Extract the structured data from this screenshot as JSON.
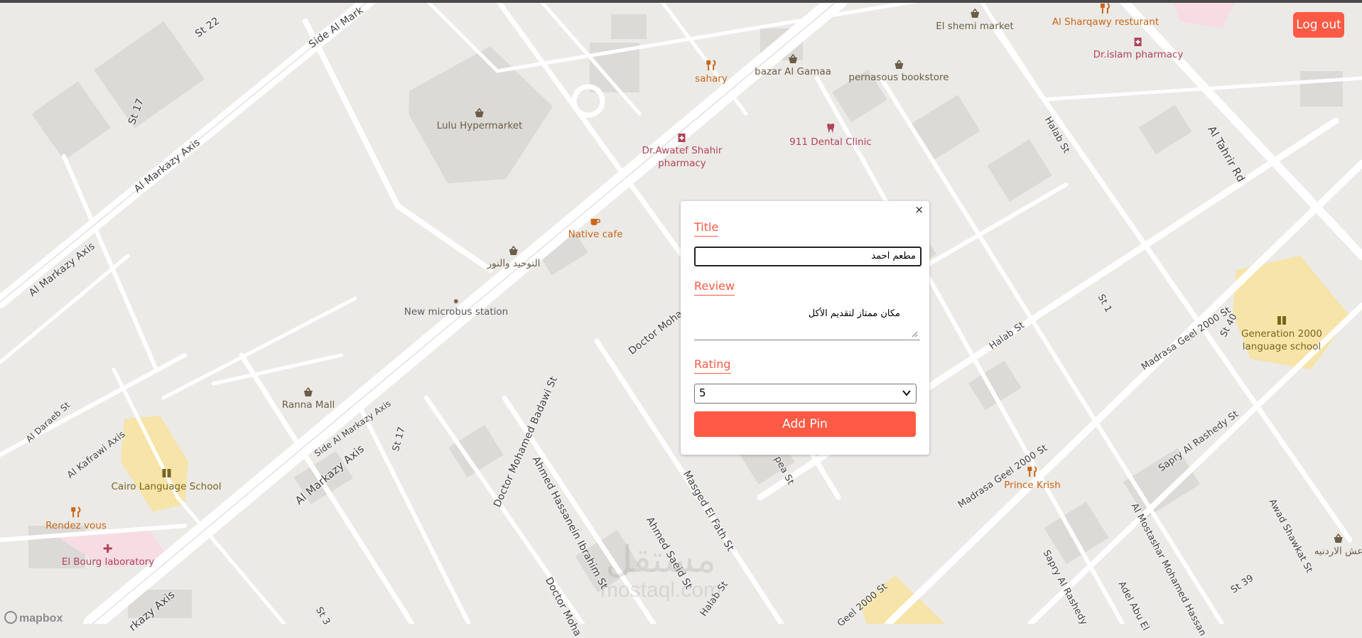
{
  "colors": {
    "accent": "#ff5a45",
    "food": "#c8661a",
    "health": "#b0435a",
    "shop": "#6b5d48",
    "school_area": "#f6e4a8"
  },
  "header": {
    "logout_label": "Log out"
  },
  "form": {
    "close_glyph": "×",
    "title_label": "Title",
    "title_value": "مطعم احمد",
    "review_label": "Review",
    "review_value": "مكان ممتاز لتقديم الأكل",
    "rating_label": "Rating",
    "rating_value": "5",
    "submit_label": "Add Pin"
  },
  "pois": [
    {
      "label": "Lulu Hypermarket",
      "icon": "basket-icon",
      "kind": "shop"
    },
    {
      "label": "sahary",
      "icon": "restaurant-icon",
      "kind": "food"
    },
    {
      "label": "bazar Al Gamaa",
      "icon": "basket-icon",
      "kind": "shop"
    },
    {
      "label": "pernasous bookstore",
      "icon": "basket-icon",
      "kind": "shop"
    },
    {
      "label": "El shemi market",
      "icon": "basket-icon",
      "kind": "shop"
    },
    {
      "label": "Al Sharqawy resturant",
      "icon": "restaurant-icon",
      "kind": "food"
    },
    {
      "label": "Dr.islam pharmacy",
      "icon": "pharmacy-icon",
      "kind": "health"
    },
    {
      "label": "Dr.Awatef Shahir",
      "label2": "pharmacy",
      "icon": "pharmacy-icon",
      "kind": "health"
    },
    {
      "label": "911 Dental Clinic",
      "icon": "tooth-icon",
      "kind": "health"
    },
    {
      "label": "Native cafe",
      "icon": "cafe-icon",
      "kind": "food"
    },
    {
      "label": "التوحيد والنور",
      "icon": "basket-icon",
      "kind": "shop"
    },
    {
      "label": "New microbus station",
      "icon": "dot-icon",
      "kind": "plain"
    },
    {
      "label": "Ranna Mall",
      "icon": "basket-icon",
      "kind": "shop"
    },
    {
      "label": "Cairo Language School",
      "icon": "school-icon",
      "kind": "school"
    },
    {
      "label": "Rendez vous",
      "icon": "restaurant-icon",
      "kind": "food"
    },
    {
      "label": "El Bourg laboratory",
      "icon": "hospital-icon",
      "kind": "health"
    },
    {
      "label": "Generation 2000",
      "label2": "language school",
      "icon": "school-icon",
      "kind": "school"
    },
    {
      "label": "Prince Krish",
      "icon": "restaurant-icon",
      "kind": "food"
    },
    {
      "label": "عش الاردنيه",
      "icon": "basket-icon",
      "kind": "shop"
    }
  ],
  "streets": [
    "St 22",
    "Side Al Mark",
    "St 17",
    "Al Markazy Axis",
    "Al Markazy Axis",
    "Al Daraeb St",
    "Al Kafrawi Axis",
    "Side Al Markazy Axis",
    "St 17",
    "Al Markazy Axis",
    "Doctor Mohamed Badawi St",
    "Ahmed Hassanein Ibrahim St",
    "Doctor Moha",
    "Doctor Moham",
    "Ahmed Saeid St",
    "Masged El Fath St",
    "pea St",
    "Halab St",
    "Halab St",
    "Halab St",
    "St 1",
    "Madrasa Geel 2000 St",
    "St 40",
    "Madrasa Geel 2000 St",
    "Geel 2000 St",
    "Sapry Al Rashedy St",
    "Sapry Al Rashedy",
    "Al Mostashar Mohamed Hassan",
    "Adel Abu El",
    "Awad Shawkat St",
    "St 39",
    "Al Tahrir Rd",
    "St 3",
    "rkazy Axis"
  ],
  "attribution": "mapbox",
  "watermark": {
    "line1": "مستقل",
    "line2": "mostaql.com"
  }
}
